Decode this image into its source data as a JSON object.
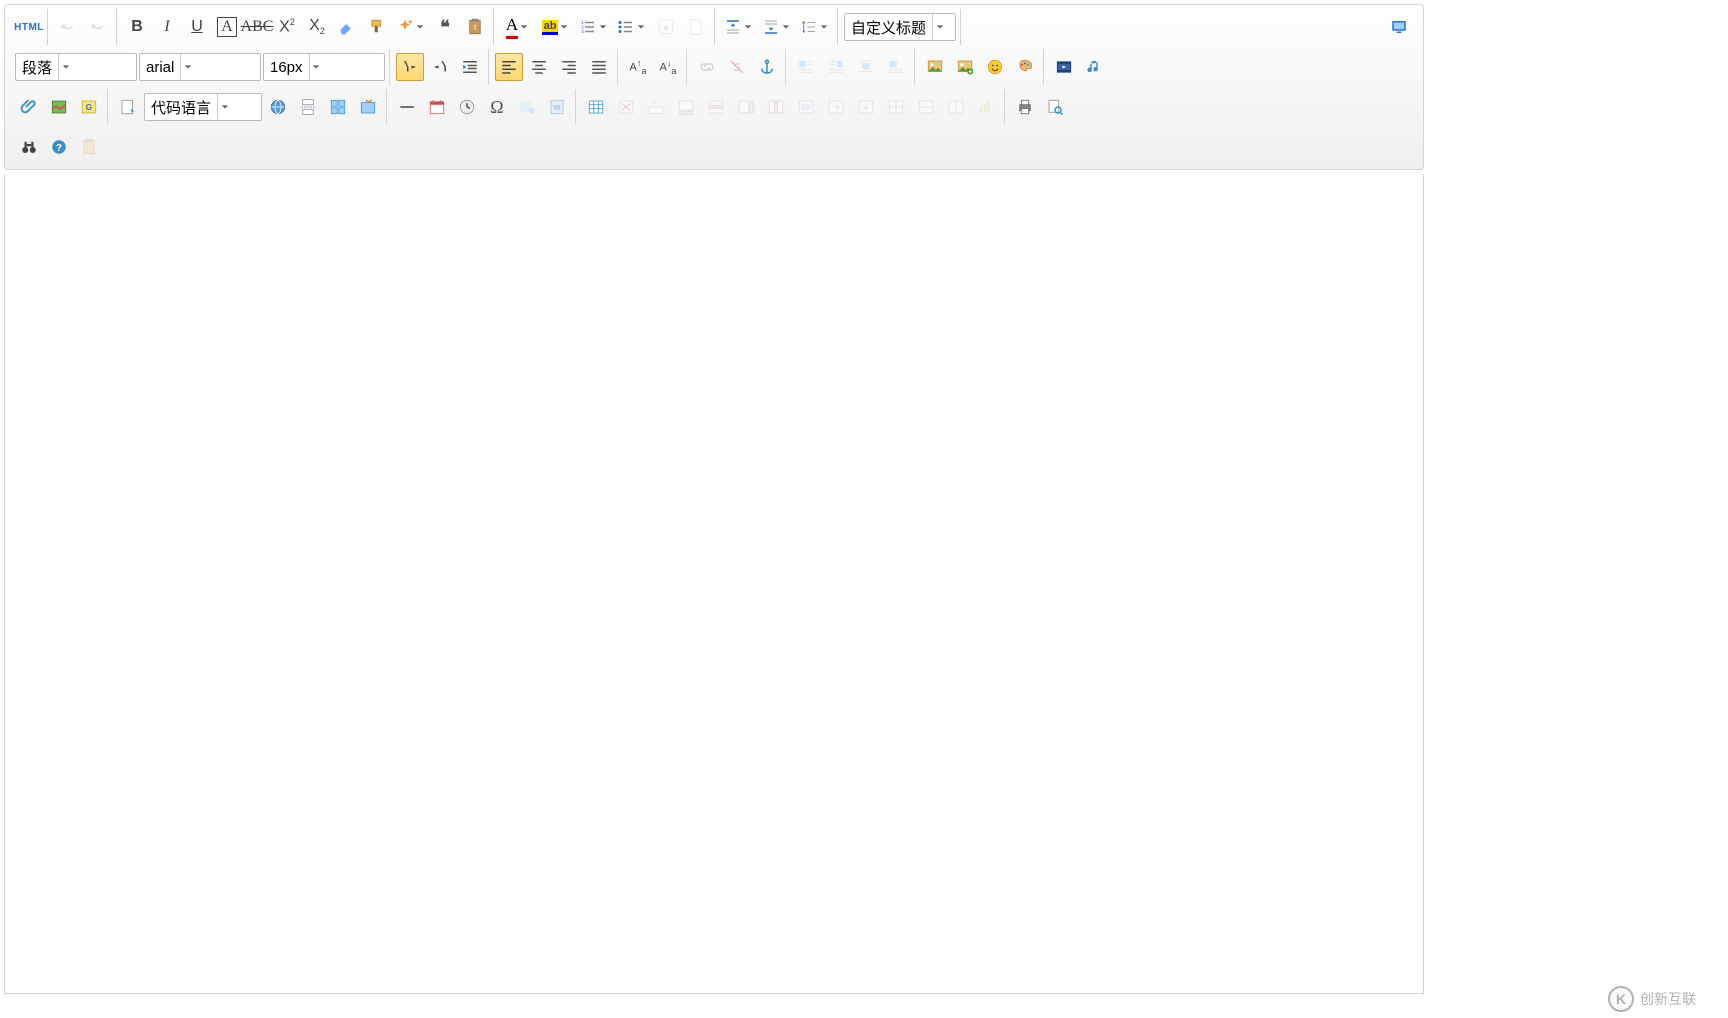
{
  "toolbar": {
    "html_label": "HTML",
    "paragraph_select": "段落",
    "font_select": "arial",
    "size_select": "16px",
    "code_lang_select": "代码语言",
    "custom_title_select": "自定义标题"
  },
  "watermark": {
    "logo_char": "K",
    "text": "创新互联"
  },
  "colors": {
    "toolbar_grad_top": "#fefefe",
    "toolbar_grad_bot": "#f0f0f0",
    "active_grad_top": "#ffe8a6",
    "active_grad_bot": "#ffd76e",
    "border": "#d4d4d4",
    "icon_blue": "#2a6fc9"
  }
}
